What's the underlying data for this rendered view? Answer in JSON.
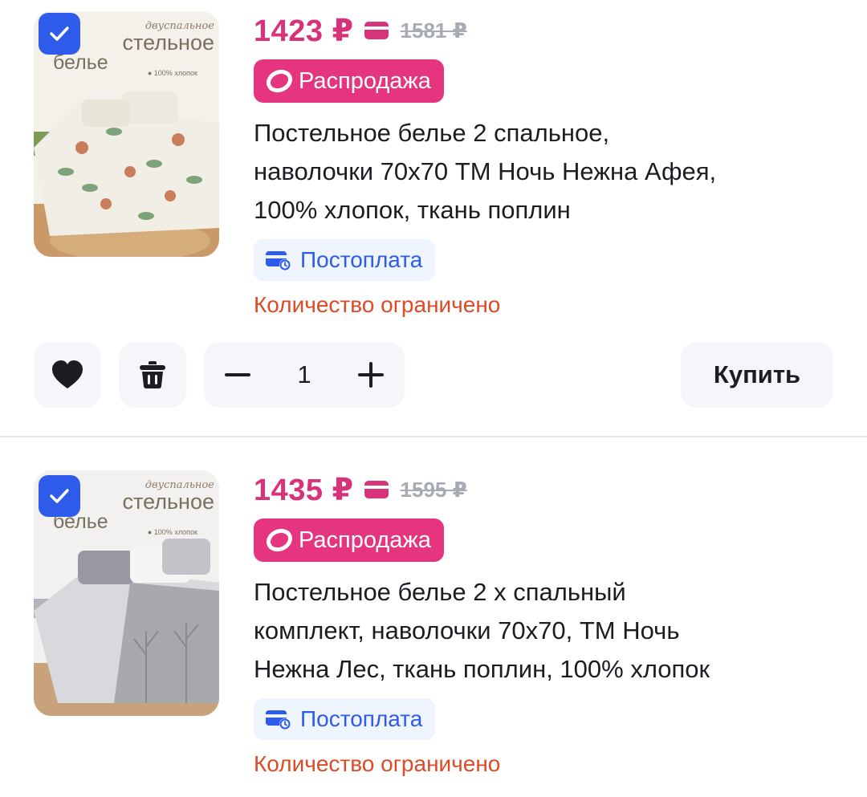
{
  "items": [
    {
      "selected": true,
      "price": "1423 ₽",
      "old_price": "1581 ₽",
      "sale_badge": "Распродажа",
      "title_lines": [
        "Постельное белье 2 спальное,",
        "наволочки 70х70 ТМ Ночь Нежна Афея,",
        "100% хлопок, ткань поплин"
      ],
      "postpay": "Постоплата",
      "limited": "Количество ограничено",
      "quantity": "1",
      "buy_label": "Купить",
      "image_text": {
        "script": "двуспальное",
        "line1": "стельное",
        "line2": "белье",
        "tag": "● 100% хлопок"
      }
    },
    {
      "selected": true,
      "price": "1435 ₽",
      "old_price": "1595 ₽",
      "sale_badge": "Распродажа",
      "title_lines": [
        "Постельное белье 2 х спальный",
        "комплект, наволочки 70х70, ТМ Ночь",
        "Нежна Лес, ткань поплин, 100% хлопок"
      ],
      "postpay": "Постоплата",
      "limited": "Количество ограничено",
      "image_text": {
        "script": "двуспальное",
        "line1": "стельное",
        "line2": "белье",
        "tag": "● 100% хлопок"
      }
    }
  ],
  "colors": {
    "accent_blue": "#2f5bea",
    "sale_pink": "#e6357f",
    "price_pink": "#d8337a",
    "warning_orange": "#dc4b26"
  },
  "icons": [
    "checkbox-checked-icon",
    "card-icon",
    "sale-ring-icon",
    "postpay-icon",
    "heart-icon",
    "trash-icon",
    "minus-icon",
    "plus-icon"
  ]
}
